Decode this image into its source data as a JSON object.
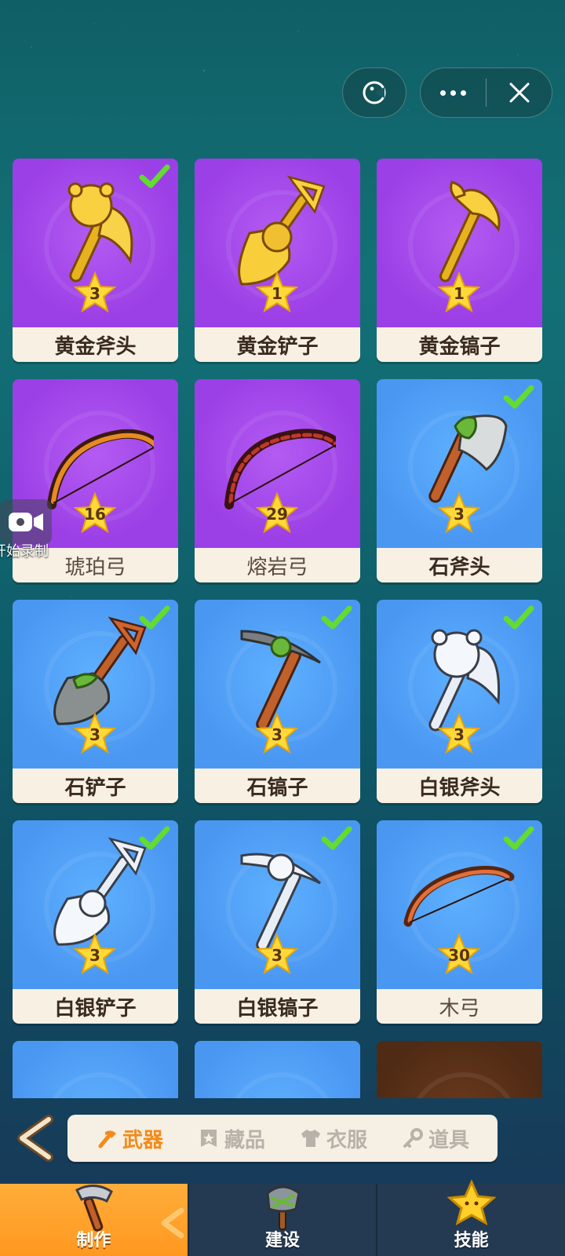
{
  "capsule": {
    "game_icon": "game-face-icon",
    "more_icon": "more-dots-icon",
    "close_icon": "close-icon"
  },
  "items": [
    {
      "name": "黄金斧头",
      "level": "3",
      "rarity": "epic",
      "owned": true,
      "icon": "golden-axe-icon"
    },
    {
      "name": "黄金铲子",
      "level": "1",
      "rarity": "epic",
      "owned": false,
      "icon": "golden-shovel-icon"
    },
    {
      "name": "黄金镐子",
      "level": "1",
      "rarity": "epic",
      "owned": false,
      "icon": "golden-pickaxe-icon"
    },
    {
      "name": "琥珀弓",
      "level": "16",
      "rarity": "epic",
      "owned": false,
      "icon": "amber-bow-icon"
    },
    {
      "name": "熔岩弓",
      "level": "29",
      "rarity": "epic",
      "owned": false,
      "icon": "lava-bow-icon"
    },
    {
      "name": "石斧头",
      "level": "3",
      "rarity": "rare",
      "owned": true,
      "icon": "stone-axe-icon"
    },
    {
      "name": "石铲子",
      "level": "3",
      "rarity": "rare",
      "owned": true,
      "icon": "stone-shovel-icon"
    },
    {
      "name": "石镐子",
      "level": "3",
      "rarity": "rare",
      "owned": true,
      "icon": "stone-pickaxe-icon"
    },
    {
      "name": "白银斧头",
      "level": "3",
      "rarity": "rare",
      "owned": true,
      "icon": "silver-axe-icon"
    },
    {
      "name": "白银铲子",
      "level": "3",
      "rarity": "rare",
      "owned": true,
      "icon": "silver-shovel-icon"
    },
    {
      "name": "白银镐子",
      "level": "3",
      "rarity": "rare",
      "owned": true,
      "icon": "silver-pickaxe-icon"
    },
    {
      "name": "木弓",
      "level": "30",
      "rarity": "rare",
      "owned": true,
      "icon": "wood-bow-icon"
    }
  ],
  "partial_items": [
    {
      "rarity": "rare",
      "icon": "fish-weapon-icon"
    },
    {
      "rarity": "rare",
      "icon": "red-weapon-icon"
    },
    {
      "rarity": "common",
      "icon": "dark-weapon-icon"
    }
  ],
  "record": {
    "label": "开始录制",
    "icon": "video-camera-icon"
  },
  "categories": [
    {
      "label": "武器",
      "icon": "hammer-icon",
      "active": true
    },
    {
      "label": "藏品",
      "icon": "star-badge-icon",
      "active": false
    },
    {
      "label": "衣服",
      "icon": "shirt-icon",
      "active": false
    },
    {
      "label": "道具",
      "icon": "key-icon",
      "active": false
    }
  ],
  "tabs": [
    {
      "label": "制作",
      "icon": "craft-hammer-icon",
      "active": true
    },
    {
      "label": "建设",
      "icon": "build-stone-icon",
      "active": false
    },
    {
      "label": "技能",
      "icon": "skill-star-icon",
      "active": false
    }
  ],
  "colors": {
    "epic": "#9b3fe6",
    "rare": "#4a97f2",
    "accent": "#f48a19",
    "tab_active": "#ff9f28"
  }
}
